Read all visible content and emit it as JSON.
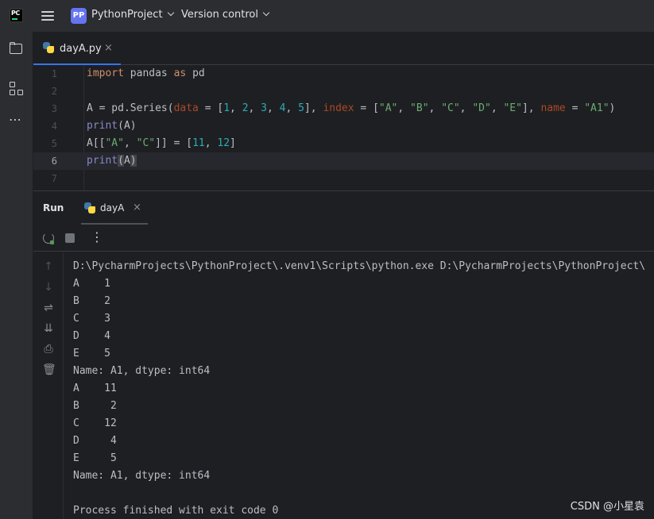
{
  "titlebar": {
    "logo_text": "PC",
    "project_initials": "PP",
    "project_name": "PythonProject",
    "vcs_label": "Version control"
  },
  "sidebar": {
    "tools": [
      {
        "name": "folder-icon"
      },
      {
        "name": "structure-icon"
      },
      {
        "name": "more-icon",
        "glyph": "⋯"
      }
    ]
  },
  "editor": {
    "tab": {
      "label": "dayA.py",
      "close": "×"
    },
    "lines": [
      {
        "num": "1",
        "text": "import pandas as pd"
      },
      {
        "num": "2",
        "text": ""
      },
      {
        "num": "3",
        "text": "A = pd.Series(data = [1, 2, 3, 4, 5], index = [\"A\", \"B\", \"C\", \"D\", \"E\"], name = \"A1\")"
      },
      {
        "num": "4",
        "text": "print(A)"
      },
      {
        "num": "5",
        "text": "A[[\"A\", \"C\"]] = [11, 12]"
      },
      {
        "num": "6",
        "text": "print(A)"
      },
      {
        "num": "7",
        "text": ""
      }
    ],
    "current_line": 6
  },
  "run": {
    "title": "Run",
    "tab": {
      "label": "dayA",
      "close": "×"
    },
    "toolbar": {
      "more_glyph": "⋮"
    },
    "console": [
      "D:\\PycharmProjects\\PythonProject\\.venv1\\Scripts\\python.exe D:\\PycharmProjects\\PythonProject\\",
      "A    1",
      "B    2",
      "C    3",
      "D    4",
      "E    5",
      "Name: A1, dtype: int64",
      "A    11",
      "B     2",
      "C    12",
      "D     4",
      "E     5",
      "Name: A1, dtype: int64",
      "",
      "Process finished with exit code 0"
    ]
  },
  "watermark": "CSDN @小星袁",
  "colors": {
    "accent": "#3574f0",
    "keyword": "#cf8e6d",
    "number": "#2aacb8",
    "string": "#6aab73",
    "param": "#aa4926",
    "builtin": "#8888c6"
  }
}
